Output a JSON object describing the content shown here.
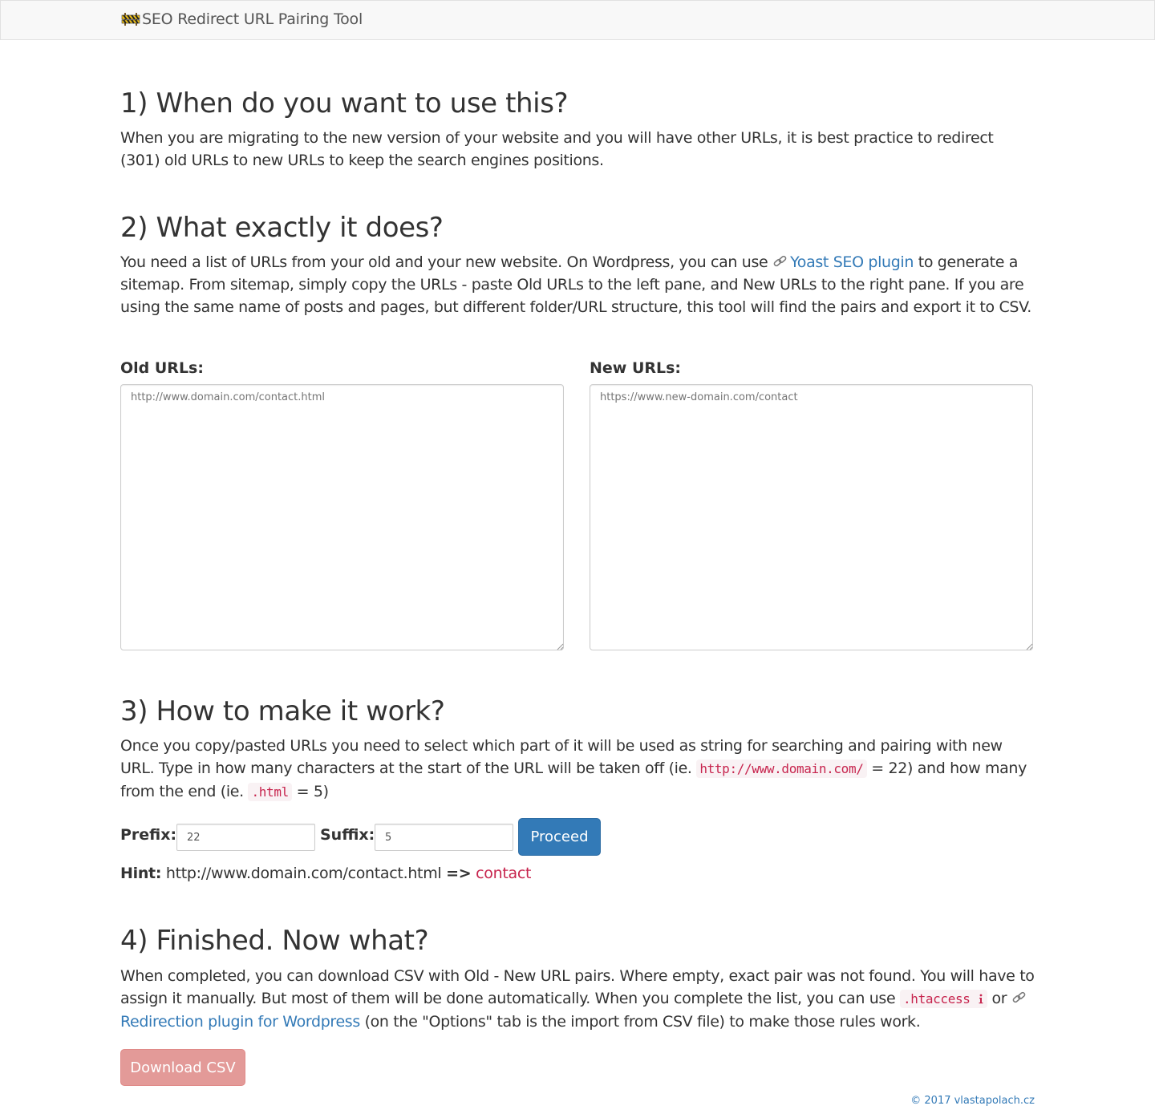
{
  "navbar": {
    "brand_icon": "construction-barrier-icon",
    "brand_title": "SEO Redirect URL Pairing Tool"
  },
  "section1": {
    "heading": "1) When do you want to use this?",
    "body": "When you are migrating to the new version of your website and you will have other URLs, it is best practice to redirect (301) old URLs to new URLs to keep the search engines positions."
  },
  "section2": {
    "heading": "2) What exactly it does?",
    "body_before_link": "You need a list of URLs from your old and your new website. On Wordpress, you can use ",
    "link_icon": "link-icon",
    "link_text": "Yoast SEO plugin",
    "body_after_link": " to generate a sitemap. From sitemap, simply copy the URLs - paste Old URLs to the left pane, and New URLs to the right pane. If you are using the same name of posts and pages, but different folder/URL structure, this tool will find the pairs and export it to CSV.",
    "old_label": "Old URLs:",
    "old_placeholder": "http://www.domain.com/contact.html",
    "new_label": "New URLs:",
    "new_placeholder": "https://www.new-domain.com/contact"
  },
  "section3": {
    "heading": "3) How to make it work?",
    "body_part1": "Once you copy/pasted URLs you need to select which part of it will be used as string for searching and pairing with new URL. Type in how many characters at the start of the URL will be taken off (ie. ",
    "code_prefix": "http://www.domain.com/",
    "body_part2": " = 22) and how many from the end (ie. ",
    "code_suffix": ".html",
    "body_part3": " = 5)",
    "prefix_label": "Prefix:",
    "prefix_value": "22",
    "suffix_label": "Suffix:",
    "suffix_value": "5",
    "proceed_label": "Proceed",
    "hint_label": "Hint:",
    "hint_url": "http://www.domain.com/contact.html",
    "hint_arrow": "=>",
    "hint_result": "contact"
  },
  "section4": {
    "heading": "4) Finished. Now what?",
    "body_part1": "When completed, you can download CSV with Old - New URL pairs. Where empty, exact pair was not found. You will have to assign it manually. But most of them will be done automatically. When you complete the list, you can use ",
    "code_htaccess": ".htaccess",
    "info_icon": "info-icon",
    "body_part2": " or ",
    "link_icon": "link-icon",
    "link_text": "Redirection plugin for Wordpress",
    "body_part3": " (on the \"Options\" tab is the import from CSV file) to make those rules work.",
    "download_label": "Download CSV"
  },
  "footer": {
    "text": "© 2017 vlastapolach.cz"
  },
  "colors": {
    "link": "#337ab7",
    "primary_button": "#337ab7",
    "danger_button_disabled": "#e39a98",
    "code_text": "#c7254e",
    "code_bg": "#f9f2f4",
    "navbar_bg": "#f8f8f8"
  }
}
